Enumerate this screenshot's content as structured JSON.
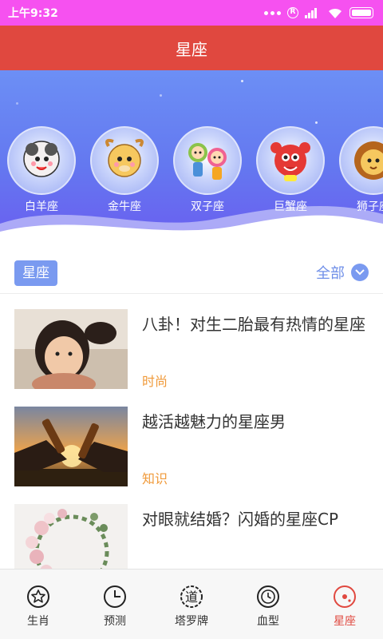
{
  "status_bar": {
    "time": "上午9:32"
  },
  "app_bar": {
    "title": "星座"
  },
  "zodiac": [
    {
      "label": "白羊座",
      "icon": "aries-mascot-icon"
    },
    {
      "label": "金牛座",
      "icon": "taurus-mascot-icon"
    },
    {
      "label": "双子座",
      "icon": "gemini-mascot-icon"
    },
    {
      "label": "巨蟹座",
      "icon": "cancer-mascot-icon"
    },
    {
      "label": "狮子座",
      "icon": "leo-mascot-icon"
    }
  ],
  "section": {
    "tag": "星座",
    "all_label": "全部"
  },
  "articles": [
    {
      "title": "八卦！对生二胎最有热情的星座",
      "tag": "时尚",
      "thumb": "girl-photo"
    },
    {
      "title": "越活越魅力的星座男",
      "tag": "知识",
      "thumb": "beer-toast-photo"
    },
    {
      "title": "对眼就结婚？闪婚的星座CP",
      "tag": "",
      "thumb": "flower-wreath-photo"
    }
  ],
  "tabs": [
    {
      "label": "生肖",
      "icon": "star-circle-icon",
      "active": false
    },
    {
      "label": "预测",
      "icon": "clock-icon",
      "active": false
    },
    {
      "label": "塔罗牌",
      "icon": "dao-icon",
      "active": false
    },
    {
      "label": "血型",
      "icon": "history-icon",
      "active": false
    },
    {
      "label": "星座",
      "icon": "zodiac-dot-icon",
      "active": true
    }
  ],
  "colors": {
    "status_bar": "#f651f0",
    "app_bar": "#e0483f",
    "accent": "#7a9af0",
    "tag_orange": "#f09a3a"
  }
}
